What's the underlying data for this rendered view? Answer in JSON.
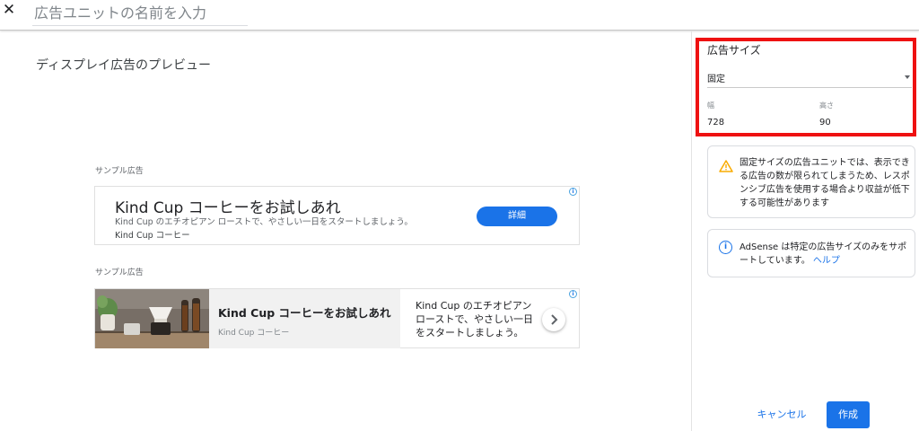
{
  "header": {
    "close_glyph": "✕",
    "name_placeholder": "広告ユニットの名前を入力"
  },
  "preview": {
    "title": "ディスプレイ広告のプレビュー",
    "ads": [
      {
        "label": "サンプル広告",
        "headline": "Kind Cup コーヒーをお試しあれ",
        "description": "Kind Cup のエチオピアン ローストで、やさしい一日をスタートしましょう。",
        "advertiser": "Kind Cup コーヒー",
        "cta": "詳細"
      },
      {
        "label": "サンプル広告",
        "headline": "Kind Cup コーヒーをお試しあれ",
        "advertiser": "Kind Cup コーヒー",
        "description": "Kind Cup のエチオピアン ローストで、やさしい一日をスタートしましょう。"
      }
    ]
  },
  "size_panel": {
    "title": "広告サイズ",
    "select_value": "固定",
    "width_label": "幅",
    "width_value": "728",
    "height_label": "高さ",
    "height_value": "90"
  },
  "notices": {
    "warning": "固定サイズの広告ユニットでは、表示できる広告の数が限られてしまうため、レスポンシブ広告を使用する場合より収益が低下する可能性があります",
    "info_text": "AdSense は特定の広告サイズのみをサポートしています。",
    "info_link": "ヘルプ"
  },
  "footer": {
    "cancel": "キャンセル",
    "create": "作成"
  },
  "colors": {
    "accent": "#1a73e8",
    "highlight_border": "#ee1111",
    "warning": "#f9ab00"
  }
}
